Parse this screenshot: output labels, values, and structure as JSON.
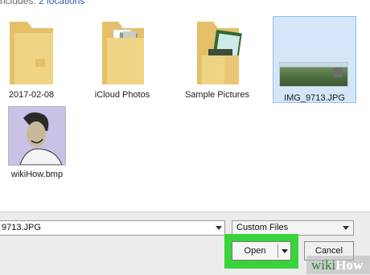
{
  "header": {
    "includes_text": "ncludes:",
    "locations_link": "2 locations"
  },
  "items": [
    {
      "label": "2017-02-08",
      "kind": "folder",
      "icon": "folder-icon"
    },
    {
      "label": "iCloud Photos",
      "kind": "folder",
      "icon": "folder-photos-icon"
    },
    {
      "label": "Sample Pictures",
      "kind": "folder",
      "icon": "folder-pictures-icon"
    },
    {
      "label": "IMG_9713.JPG",
      "kind": "image",
      "icon": "photo-thumbnail",
      "selected": true
    },
    {
      "label": "wikiHow.bmp",
      "kind": "image",
      "icon": "drawing-thumbnail"
    }
  ],
  "filename_field": {
    "value": "9713.JPG"
  },
  "file_type": {
    "selected": "Custom Files"
  },
  "buttons": {
    "open": "Open",
    "cancel": "Cancel"
  },
  "watermark": {
    "wiki": "wiki",
    "how": "How"
  },
  "colors": {
    "folder": "#e9c776",
    "selection": "#d5e6f8",
    "highlight": "#39d33c"
  }
}
